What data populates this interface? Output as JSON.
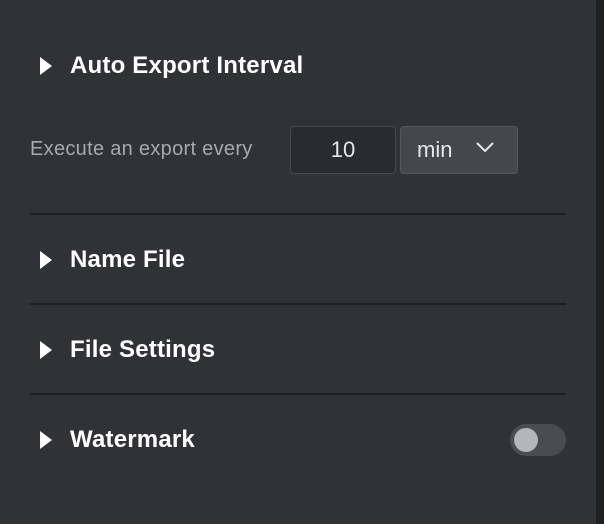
{
  "sections": {
    "auto_export": {
      "title": "Auto Export Interval",
      "interval_label": "Execute an export every",
      "interval_value": "10",
      "unit_selected": "min",
      "expanded": true
    },
    "name_file": {
      "title": "Name File",
      "expanded": false
    },
    "file_settings": {
      "title": "File Settings",
      "expanded": false
    },
    "watermark": {
      "title": "Watermark",
      "expanded": false,
      "enabled": false
    }
  },
  "icons": {
    "section_caret": "caret-right-icon",
    "select_chevron": "chevron-down-icon"
  },
  "colors": {
    "panel_background": "#303236",
    "divider": "#1e1f22",
    "title_text": "#ffffff",
    "label_text": "#a6a8ad",
    "toggle_off_track": "#4a4c51"
  }
}
